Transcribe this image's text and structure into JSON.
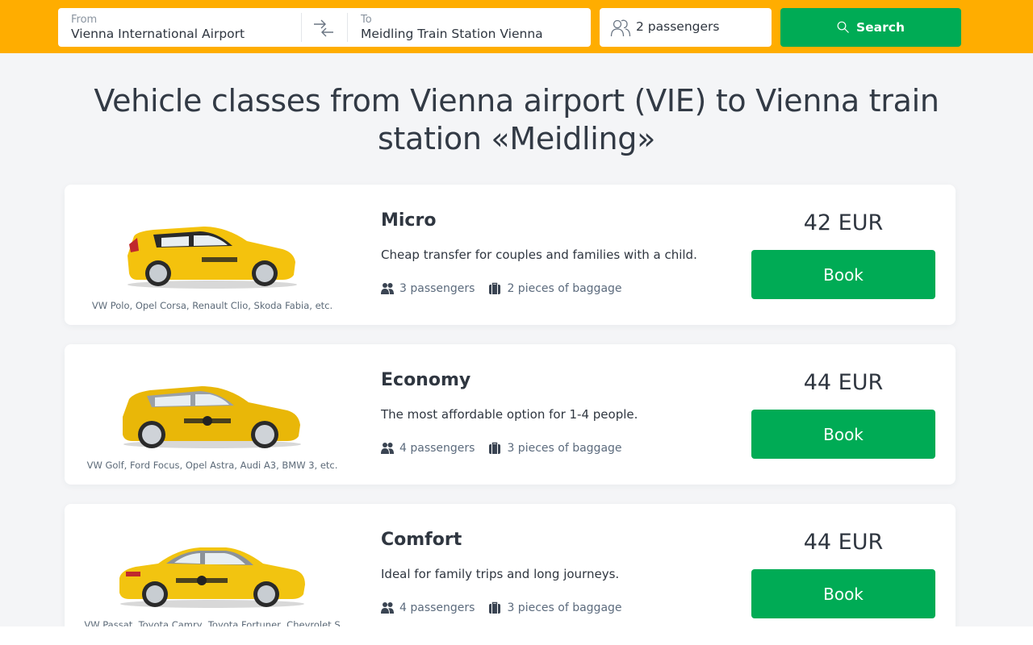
{
  "search": {
    "from_label": "From",
    "from_value": "Vienna International Airport",
    "to_label": "To",
    "to_value": "Meidling Train Station Vienna",
    "swap_icon": "swap-arrows-icon",
    "passengers": "2 passengers",
    "passengers_icon": "users-icon",
    "search_button": "Search",
    "search_icon": "search-icon"
  },
  "colors": {
    "brand_yellow": "#ffad00",
    "action_green": "#00ab55",
    "page_background": "#f4f5f7"
  },
  "page_title": "Vehicle classes from Vienna airport (VIE) to Vienna train station «Meidling»",
  "vehicles": [
    {
      "name": "Micro",
      "description": "Cheap transfer for couples and families with a child.",
      "passengers": "3 passengers",
      "baggage": "2 pieces of baggage",
      "models": "VW Polo, Opel Corsa, Renault Clio, Skoda Fabia, etc.",
      "price": "42 EUR",
      "book_label": "Book",
      "image": "yellow-hatchback-taxi"
    },
    {
      "name": "Economy",
      "description": "The most affordable option for 1-4 people.",
      "passengers": "4 passengers",
      "baggage": "3 pieces of baggage",
      "models": "VW Golf, Ford Focus, Opel Astra, Audi A3, BMW 3, etc.",
      "price": "44 EUR",
      "book_label": "Book",
      "image": "yellow-hatchback-taxi"
    },
    {
      "name": "Comfort",
      "description": "Ideal for family trips and long journeys.",
      "passengers": "4 passengers",
      "baggage": "3 pieces of baggage",
      "models": "VW Passat, Toyota Camry, Toyota Fortuner, Chevrolet S",
      "price": "44 EUR",
      "book_label": "Book",
      "image": "yellow-sedan-taxi"
    }
  ]
}
